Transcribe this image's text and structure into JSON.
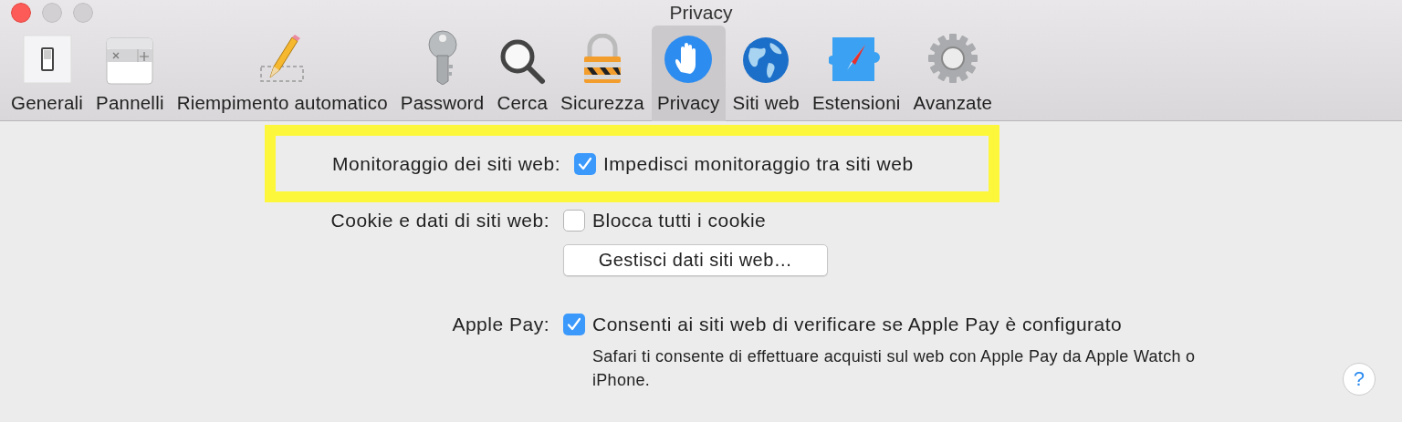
{
  "window": {
    "title": "Privacy"
  },
  "tabs": [
    {
      "label": "Generali",
      "selected": false,
      "kind": "switch"
    },
    {
      "label": "Pannelli",
      "selected": false,
      "kind": "panels"
    },
    {
      "label": "Riempimento automatico",
      "selected": false,
      "kind": "pencil"
    },
    {
      "label": "Password",
      "selected": false,
      "kind": "key"
    },
    {
      "label": "Cerca",
      "selected": false,
      "kind": "search"
    },
    {
      "label": "Sicurezza",
      "selected": false,
      "kind": "lock"
    },
    {
      "label": "Privacy",
      "selected": true,
      "kind": "hand"
    },
    {
      "label": "Siti web",
      "selected": false,
      "kind": "globe"
    },
    {
      "label": "Estensioni",
      "selected": false,
      "kind": "puzzle"
    },
    {
      "label": "Avanzate",
      "selected": false,
      "kind": "gear"
    }
  ],
  "settings": [
    {
      "kind": "checkbox",
      "label": "Monitoraggio dei siti web:",
      "option": "Impedisci monitoraggio tra siti web",
      "checked": true,
      "highlighted": true
    },
    {
      "kind": "checkbox",
      "label": "Cookie e dati di siti web:",
      "option": "Blocca tutti i cookie",
      "checked": false,
      "highlighted": false
    },
    {
      "kind": "button",
      "option": "Gestisci dati siti web…"
    },
    {
      "kind": "checkbox",
      "label": "Apple Pay:",
      "option": "Consenti ai siti web di verificare se Apple Pay è configurato",
      "checked": true,
      "highlighted": false,
      "note": "Safari ti consente di effettuare acquisti sul web con Apple Pay da Apple Watch o iPhone."
    }
  ],
  "help_button": {
    "label": "?"
  }
}
